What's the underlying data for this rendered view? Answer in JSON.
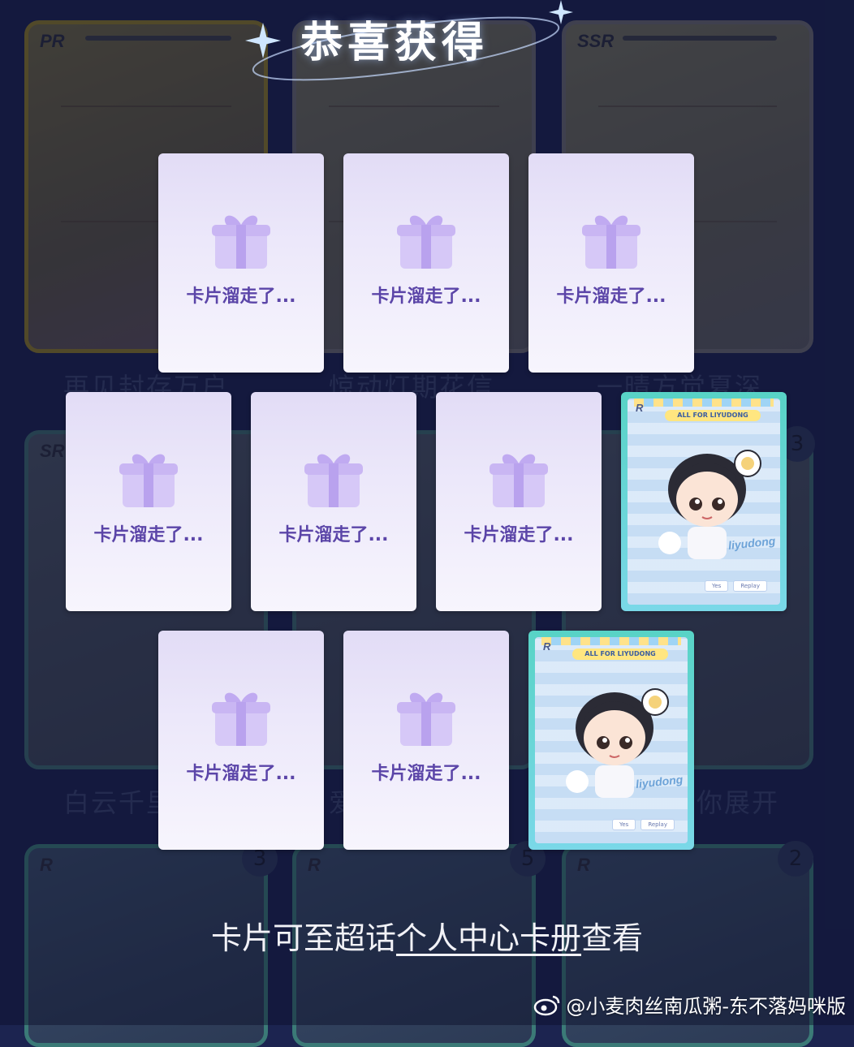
{
  "heading": {
    "title": "恭喜获得"
  },
  "background": {
    "cards": [
      {
        "rarity": "PR"
      },
      {
        "rarity": ""
      },
      {
        "rarity": "SSR"
      },
      {
        "rarity": "SR"
      },
      {
        "rarity": "R"
      },
      {
        "rarity": "R"
      },
      {
        "rarity": "R"
      }
    ],
    "titles": [
      "再见封存万户",
      "惊动灯期花信",
      "一晴方觉夏深",
      "白云千里",
      "爱",
      "你展开"
    ],
    "counts": [
      "3",
      "3",
      "5",
      "2"
    ]
  },
  "results": {
    "empty_label": "卡片溜走了...",
    "win_badge": "R",
    "win_banner": "ALL FOR LIYUDONG",
    "win_name": "liyudong",
    "win_buttons": [
      "Yes",
      "Replay"
    ]
  },
  "footer": {
    "prefix": "卡片可至超话",
    "link": "个人中心卡册",
    "suffix": "查看"
  },
  "watermark": {
    "text": "@小麦肉丝南瓜粥-东不落妈咪版"
  },
  "colors": {
    "background": "#1c2450",
    "empty_label": "#5b45a8",
    "win_border": "#58d3c6"
  },
  "icons": {
    "gift": "gift-box-icon",
    "sparkle": "sparkle-icon",
    "weibo": "weibo-logo-icon"
  }
}
